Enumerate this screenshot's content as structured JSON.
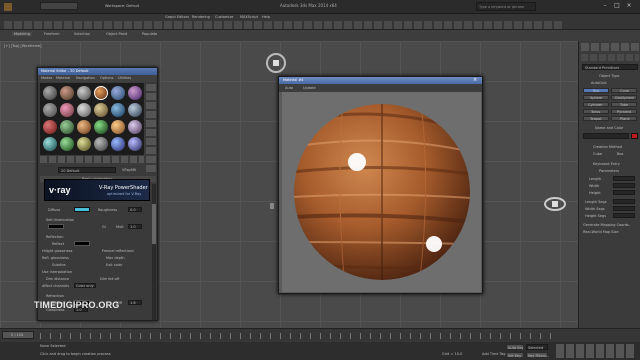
{
  "app": {
    "title": "Autodesk 3ds Max 2014 x64",
    "workspace": "Workspace: Default",
    "search_placeholder": "Type a keyword or phrase"
  },
  "ribbon": {
    "tabs": [
      "Modeling",
      "Freeform",
      "Selection",
      "Object Paint",
      "Populate"
    ],
    "subtag": "Polygon Modeling",
    "menus": [
      "Graph Editors",
      "Rendering",
      "Customize",
      "MAXScript",
      "Help"
    ]
  },
  "viewport": {
    "label": "[+] [Top] [Wireframe]"
  },
  "material_editor": {
    "title": "Material Editor - 20 Default",
    "menu": [
      "Modes",
      "Material",
      "Navigation",
      "Options",
      "Utilities"
    ],
    "material_name": "20 Default",
    "material_type": "VRayMtl",
    "rollout_basic": "Basic parameters",
    "banner_logo": "v·ray",
    "banner_title": "V-Ray PowerShader",
    "banner_sub": "optimized for V-Ray",
    "diffuse_label": "Diffuse",
    "roughness_label": "Roughness",
    "roughness_value": "0.0",
    "self_illum_label": "Self-illumination",
    "gi_label": "GI",
    "mult_label": "Mult",
    "mult_value": "1.0",
    "reflection_label": "Reflection",
    "reflect_label": "Reflect",
    "hilight_gloss_label": "Hilight glossiness",
    "refl_gloss_label": "Refl. glossiness",
    "subdivs_label": "Subdivs",
    "use_interp_label": "Use interpolation",
    "dim_distance_label": "Dim distance",
    "affect_channels_label": "Affect channels",
    "affect_channels_value": "Color only",
    "fresnel_label": "Fresnel reflections",
    "max_depth_label": "Max depth",
    "exit_color_label": "Exit color",
    "dim_falloff_label": "Dim fall off",
    "refraction_label": "Refraction",
    "refract_label": "Refract",
    "ior_label": "IOR",
    "ior_value": "1.6",
    "glossiness_label": "Glossiness",
    "glossiness_value": "1.0"
  },
  "preview": {
    "title": "Material #4",
    "toolbar": [
      "Auto",
      "Update"
    ]
  },
  "command_panel": {
    "dropdown": "Standard Primitives",
    "object_type": "Object Type",
    "autogrid": "AutoGrid",
    "buttons": [
      "Box",
      "Cone",
      "Sphere",
      "GeoSphere",
      "Cylinder",
      "Tube",
      "Torus",
      "Pyramid",
      "Teapot",
      "Plane"
    ],
    "name_color": "Name and Color",
    "creation_method": "Creation Method",
    "cube": "Cube",
    "box": "Box",
    "keyboard_entry": "Keyboard Entry",
    "parameters": "Parameters",
    "length": "Length",
    "width": "Width",
    "height": "Height",
    "length_segs": "Length Segs",
    "width_segs": "Width Segs",
    "height_segs": "Height Segs",
    "gen_mapping": "Generate Mapping Coords.",
    "real_world": "Real-World Map Size"
  },
  "status": {
    "frame": "0 / 100",
    "selection": "None Selected",
    "prompt": "Click and drag to begin creation process",
    "grid": "Grid = 10.0",
    "auto_key": "Auto Key",
    "set_key": "Set Key",
    "selected": "Selected",
    "key_filters": "Key Filters...",
    "add_time_tag": "Add Time Tag"
  },
  "watermark": "TIMEDIGIPRO.ORG",
  "colors": {
    "accent_blue": "#4a6aa5",
    "wood_dark": "#6a3419",
    "wood_light": "#c87d4a"
  }
}
